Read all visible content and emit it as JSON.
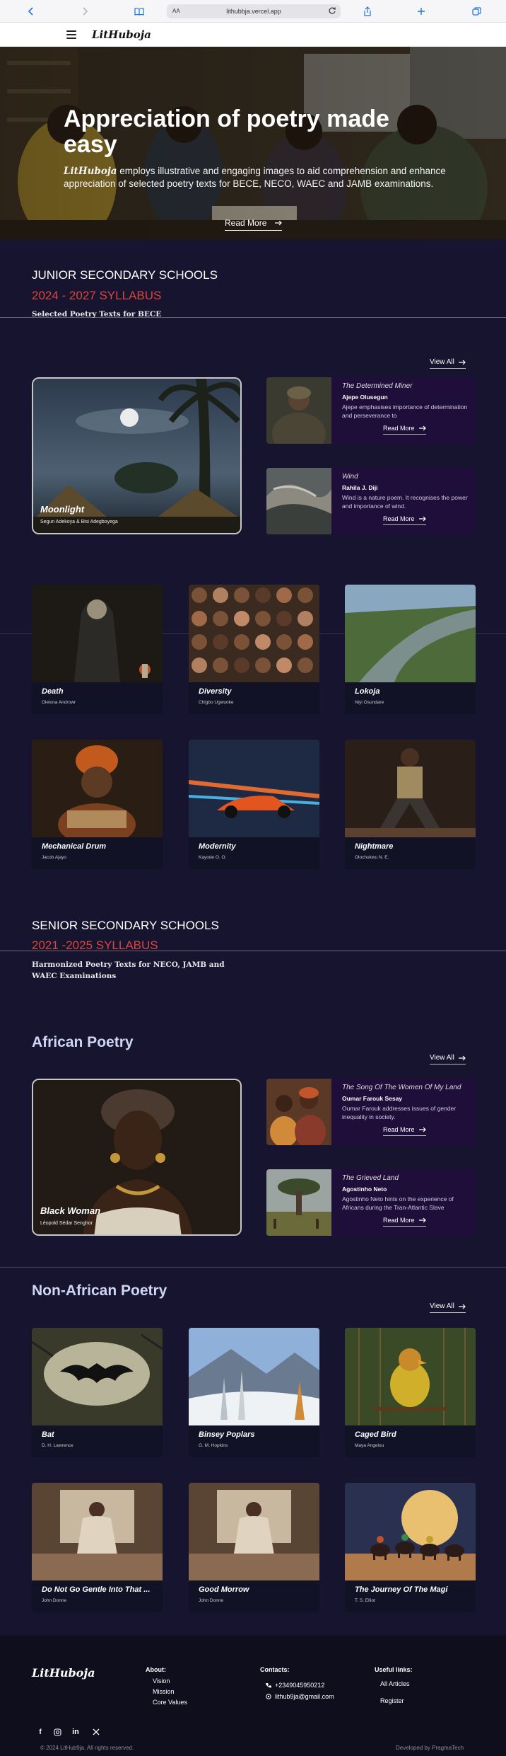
{
  "browser": {
    "aa": "AA",
    "url": "lithubbja.vercel.app",
    "back_icon": "chevron-left-icon",
    "forward_icon": "chevron-right-icon",
    "book_icon": "book-icon",
    "share_icon": "share-icon",
    "new_tab_icon": "plus-icon",
    "tabs_icon": "tabs-icon"
  },
  "header": {
    "logo": "LitHuboja"
  },
  "hero": {
    "title": "Appreciation of poetry made easy",
    "desc_brand": "LitHuboja",
    "desc_rest": " employs illustrative and engaging images to aid comprehension and enhance appreciation of selected poetry texts for BECE, NECO, WAEC and JAMB examinations.",
    "read_more": "Read More"
  },
  "junior": {
    "heading": "JUNIOR SECONDARY SCHOOLS",
    "syllabus": "2024 - 2027 SYLLABUS",
    "subtitle": "Selected Poetry Texts for BECE",
    "view_all": "View All",
    "feature": {
      "title": "Moonlight",
      "author": "Segun Adekoya & Bisi Adegboyega"
    },
    "side": [
      {
        "title": "The Determined Miner",
        "author": "Ajepe Olusegun",
        "desc": "Ajepe emphasises importance of determination and perseverance to",
        "read": "Read More"
      },
      {
        "title": "Wind",
        "author": "Rahila J. Diji",
        "desc": "Wind is a nature poem. It recognises the power and importance of wind.",
        "read": "Read More"
      }
    ],
    "grid": [
      {
        "title": "Death",
        "author": "Oleiona Androwr"
      },
      {
        "title": "Diversity",
        "author": "Chigbo Ugwuoke"
      },
      {
        "title": "Lokoja",
        "author": "Niyi Osundare"
      },
      {
        "title": "Mechanical Drum",
        "author": "Jacob Ajayo"
      },
      {
        "title": "Modernity",
        "author": "Kayode O. O."
      },
      {
        "title": "Nightmare",
        "author": "Olochukwu N. E."
      }
    ]
  },
  "senior": {
    "heading": "SENIOR SECONDARY SCHOOLS",
    "syllabus": "2021 -2025 SYLLABUS",
    "subtitle": "Harmonized Poetry Texts for NECO, JAMB and WAEC Examinations"
  },
  "african": {
    "title": "African Poetry",
    "view_all": "View All",
    "feature": {
      "title": "Black Woman",
      "author": "Léopold Sédar Senghor"
    },
    "side": [
      {
        "title": "The Song Of The Women Of My Land",
        "author": "Oumar Farouk Sesay",
        "desc": "Oumar Farouk addresses issues of gender inequality in society.",
        "read": "Read More"
      },
      {
        "title": "The Grieved Land",
        "author": "Agostinho Neto",
        "desc": "Agostinho Neto hints on the experience of Africans during the Tran-Atlantic Slave",
        "read": "Read More"
      }
    ]
  },
  "non_african": {
    "title": "Non-African Poetry",
    "view_all": "View All",
    "grid": [
      {
        "title": "Bat",
        "author": "D. H. Lawrence"
      },
      {
        "title": "Binsey Poplars",
        "author": "G. M. Hopkins"
      },
      {
        "title": "Caged Bird",
        "author": "Maya Angelou"
      },
      {
        "title": "Do Not Go Gentle Into That ...",
        "author": "John Donne"
      },
      {
        "title": "Good Morrow",
        "author": "John Donne"
      },
      {
        "title": "The Journey Of The Magi",
        "author": "T. S. Elliot"
      }
    ]
  },
  "footer": {
    "logo": "LitHuboja",
    "about_head": "About:",
    "about_links": [
      "Vision",
      "Mission",
      "Core Values"
    ],
    "contacts_head": "Contacts:",
    "phone": "+2349045950212",
    "email": "lithub9ja@gmail.com",
    "useful_head": "Useful links:",
    "useful_links": [
      "All Articles",
      "Register"
    ],
    "copyright": "© 2024 LitHub9ja. All rights reserved.",
    "developed_by": "Developed by  PragmaTech"
  },
  "colors": {
    "page_bg": "#16142f",
    "accent_red": "#d9473d",
    "side_card_bg": "#1f0e3a",
    "cat_title": "#cfd6f3"
  }
}
